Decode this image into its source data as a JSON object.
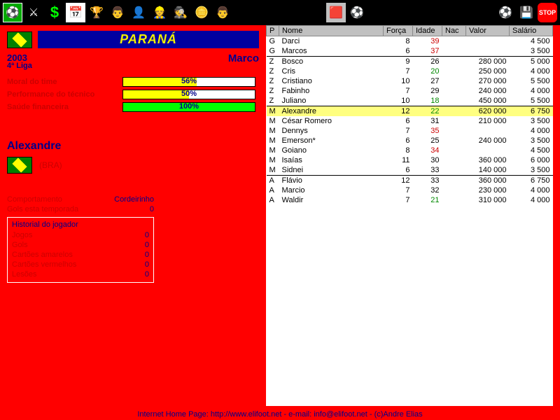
{
  "toolbar": {
    "icons": [
      "field-icon",
      "tactics-icon",
      "money-icon",
      "calendar-icon",
      "trophy-icon",
      "manager-icon",
      "pharaoh-icon",
      "worker-icon",
      "spy-icon",
      "coins-icon",
      "coach-icon"
    ],
    "right_icons": [
      "red-card-icon",
      "ball-icon",
      "ball2-icon",
      "save-icon",
      "stop-icon"
    ]
  },
  "team": {
    "name": "PARANÁ",
    "year": "2003",
    "league": "4ª Liga",
    "coach": "Marco"
  },
  "meters": {
    "morale": {
      "label": "Moral do time",
      "pct": 56,
      "text": "56%",
      "color": "#ffff00"
    },
    "perf": {
      "label": "Performance do técnico",
      "pct": 50,
      "text": "50%",
      "color": "#ffff00"
    },
    "fin": {
      "label": "Saúde financeira",
      "pct": 100,
      "text": "100%",
      "color": "#00ff00"
    }
  },
  "player": {
    "name": "Alexandre",
    "nat": "(BRA)",
    "behavior_k": "Comportamento",
    "behavior_v": "Cordeirinho",
    "goals_k": "Gols esta temporada",
    "goals_v": "0",
    "history_title": "Historial do jogador",
    "history": [
      {
        "k": "Jogos",
        "v": "0"
      },
      {
        "k": "Gols",
        "v": "0"
      },
      {
        "k": "Cartões amarelos",
        "v": "0"
      },
      {
        "k": "Cartões vermelhos",
        "v": "0"
      },
      {
        "k": "Lesões",
        "v": "0"
      }
    ]
  },
  "roster": {
    "headers": {
      "p": "P",
      "nome": "Nome",
      "forca": "Força",
      "idade": "Idade",
      "nac": "Nac",
      "valor": "Valor",
      "salario": "Salário"
    },
    "rows": [
      {
        "p": "G",
        "nome": "Darci",
        "f": "8",
        "i": "39",
        "ic": "r",
        "val": "",
        "sal": "4 500"
      },
      {
        "p": "G",
        "nome": "Marcos",
        "f": "6",
        "i": "37",
        "ic": "r",
        "val": "",
        "sal": "3 500"
      },
      {
        "p": "Z",
        "nome": "Bosco",
        "f": "9",
        "i": "26",
        "val": "280 000",
        "sal": "5 000",
        "sep": true
      },
      {
        "p": "Z",
        "nome": "Cris",
        "f": "7",
        "i": "20",
        "ic": "g",
        "val": "250 000",
        "sal": "4 000"
      },
      {
        "p": "Z",
        "nome": "Cristiano",
        "f": "10",
        "i": "27",
        "val": "270 000",
        "sal": "5 500"
      },
      {
        "p": "Z",
        "nome": "Fabinho",
        "f": "7",
        "i": "29",
        "val": "240 000",
        "sal": "4 000"
      },
      {
        "p": "Z",
        "nome": "Juliano",
        "f": "10",
        "i": "18",
        "ic": "g",
        "val": "450 000",
        "sal": "5 500"
      },
      {
        "p": "M",
        "nome": "Alexandre",
        "f": "12",
        "i": "22",
        "ic": "g",
        "val": "620 000",
        "sal": "6 750",
        "sel": true,
        "sep": true
      },
      {
        "p": "M",
        "nome": "César Romero",
        "f": "6",
        "i": "31",
        "val": "210 000",
        "sal": "3 500"
      },
      {
        "p": "M",
        "nome": "Dennys",
        "f": "7",
        "i": "35",
        "ic": "r",
        "val": "",
        "sal": "4 000"
      },
      {
        "p": "M",
        "nome": "Emerson*",
        "f": "6",
        "i": "25",
        "val": "240 000",
        "sal": "3 500"
      },
      {
        "p": "M",
        "nome": "Goiano",
        "f": "8",
        "i": "34",
        "ic": "r",
        "val": "",
        "sal": "4 500"
      },
      {
        "p": "M",
        "nome": "Isaías",
        "f": "11",
        "i": "30",
        "val": "360 000",
        "sal": "6 000"
      },
      {
        "p": "M",
        "nome": "Sidnei",
        "f": "6",
        "i": "33",
        "val": "140 000",
        "sal": "3 500"
      },
      {
        "p": "A",
        "nome": "Flávio",
        "f": "12",
        "i": "33",
        "val": "360 000",
        "sal": "6 750",
        "sep": true
      },
      {
        "p": "A",
        "nome": "Marcio",
        "f": "7",
        "i": "32",
        "val": "230 000",
        "sal": "4 000"
      },
      {
        "p": "A",
        "nome": "Waldir",
        "f": "7",
        "i": "21",
        "ic": "g",
        "val": "310 000",
        "sal": "4 000"
      }
    ]
  },
  "footer": "Internet Home Page: http://www.elifoot.net - e-mail: info@elifoot.net - (c)Andre Elias"
}
